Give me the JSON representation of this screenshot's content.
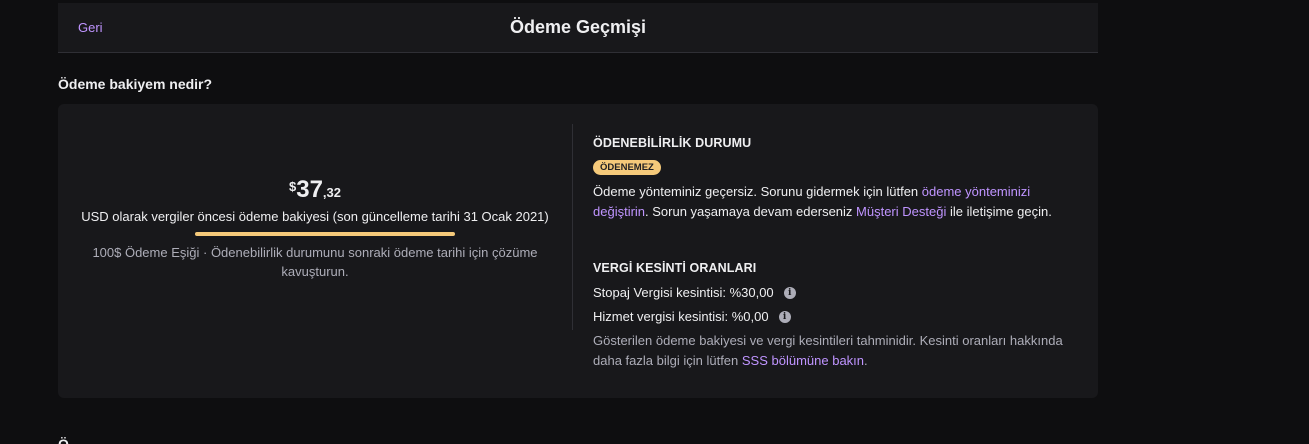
{
  "header": {
    "back_label": "Geri",
    "title": "Ödeme Geçmişi"
  },
  "section": {
    "title": "Ödeme bakiyem nedir?"
  },
  "balance": {
    "currency_symbol": "$",
    "amount_integer": "37",
    "amount_decimal": ",32",
    "description": "USD olarak vergiler öncesi ödeme bakiyesi (son güncelleme tarihi 31 Ocak 2021)",
    "threshold_note": "100$ Ödeme Eşiği · Ödenebilirlik durumunu sonraki ödeme tarihi için çözüme kavuşturun.",
    "underline_color": "#f5c97a"
  },
  "payability": {
    "title": "ÖDENEBİLİRLİK DURUMU",
    "status_badge": "ÖDENEMEZ",
    "badge_color": "#f5c97a",
    "text_part1": "Ödeme yönteminiz geçersiz. Sorunu gidermek için lütfen ",
    "link_payment_method": "ödeme yönteminizi değiştirin",
    "text_part2": ". Sorun yaşamaya devam ederseniz ",
    "link_support": "Müşteri Desteği",
    "text_part3": " ile iletişime geçin."
  },
  "tax": {
    "title": "VERGİ KESİNTİ ORANLARI",
    "withholding_label": "Stopaj Vergisi kesintisi: %30,00",
    "service_label": "Hizmet vergisi kesintisi: %0,00",
    "info_icon": "info-icon",
    "note_part1": "Gösterilen ödeme bakiyesi ve vergi kesintileri tahminidir. Kesinti oranları hakkında daha fazla bilgi için lütfen ",
    "note_link": "SSS bölümüne bakın",
    "note_part2": "."
  },
  "next_section": {
    "title_peek": "Ö"
  },
  "colors": {
    "background": "#0e0e10",
    "card": "#18181b",
    "accent_link": "#bf94ff",
    "muted_text": "#adadb8"
  }
}
